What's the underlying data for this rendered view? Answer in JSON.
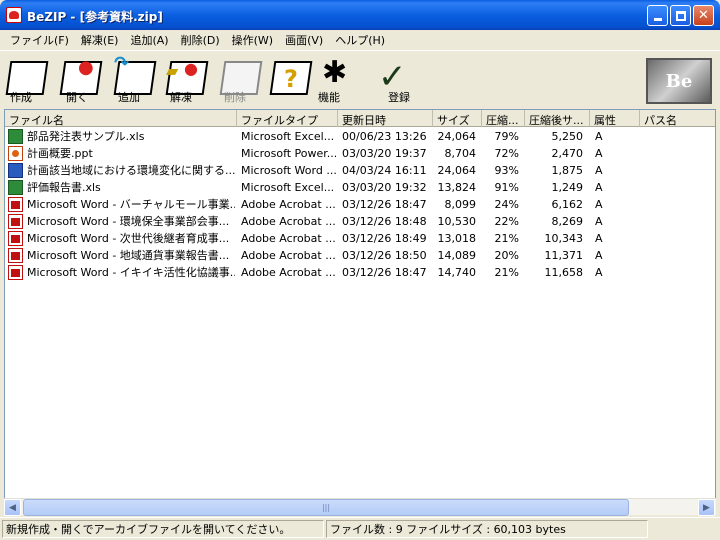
{
  "window": {
    "title": "BeZIP - [参考資料.zip]"
  },
  "menubar": {
    "items": [
      "ファイル(F)",
      "解凍(E)",
      "追加(A)",
      "削除(D)",
      "操作(W)",
      "画面(V)",
      "ヘルプ(H)"
    ]
  },
  "toolbar": {
    "items": [
      {
        "label": "作成",
        "icon": "new-archive-icon",
        "enabled": true
      },
      {
        "label": "開く",
        "icon": "open-archive-icon",
        "enabled": true
      },
      {
        "label": "追加",
        "icon": "add-files-icon",
        "enabled": true
      },
      {
        "label": "解凍",
        "icon": "extract-icon",
        "enabled": true
      },
      {
        "label": "削除",
        "icon": "delete-icon",
        "enabled": false
      },
      {
        "label": "?",
        "icon": "help-icon",
        "enabled": true
      },
      {
        "label": "機能",
        "icon": "functions-icon",
        "enabled": true
      },
      {
        "label": "登録",
        "icon": "register-check-icon",
        "enabled": true
      }
    ],
    "logo_text": "Be"
  },
  "list": {
    "columns": [
      "ファイル名",
      "ファイルタイプ",
      "更新日時",
      "サイズ",
      "圧縮...",
      "圧縮後サ...",
      "属性",
      "パス名"
    ],
    "rows": [
      {
        "icon": "xls",
        "name": "部品発注表サンプル.xls",
        "type": "Microsoft Excel...",
        "date": "00/06/23 13:26",
        "size": "24,064",
        "ratio": "79%",
        "packed": "5,250",
        "attr": "A",
        "path": ""
      },
      {
        "icon": "ppt",
        "name": "計画概要.ppt",
        "type": "Microsoft Power...",
        "date": "03/03/20 19:37",
        "size": "8,704",
        "ratio": "72%",
        "packed": "2,470",
        "attr": "A",
        "path": ""
      },
      {
        "icon": "doc",
        "name": "計画該当地域における環境変化に関する...",
        "type": "Microsoft Word ...",
        "date": "04/03/24 16:11",
        "size": "24,064",
        "ratio": "93%",
        "packed": "1,875",
        "attr": "A",
        "path": ""
      },
      {
        "icon": "xls",
        "name": "評価報告書.xls",
        "type": "Microsoft Excel...",
        "date": "03/03/20 19:32",
        "size": "13,824",
        "ratio": "91%",
        "packed": "1,249",
        "attr": "A",
        "path": ""
      },
      {
        "icon": "pdf",
        "name": "Microsoft Word - バーチャルモール事業...",
        "type": "Adobe Acrobat ...",
        "date": "03/12/26 18:47",
        "size": "8,099",
        "ratio": "24%",
        "packed": "6,162",
        "attr": "A",
        "path": ""
      },
      {
        "icon": "pdf",
        "name": "Microsoft Word - 環境保全事業部会事...",
        "type": "Adobe Acrobat ...",
        "date": "03/12/26 18:48",
        "size": "10,530",
        "ratio": "22%",
        "packed": "8,269",
        "attr": "A",
        "path": ""
      },
      {
        "icon": "pdf",
        "name": "Microsoft Word - 次世代後継者育成事...",
        "type": "Adobe Acrobat ...",
        "date": "03/12/26 18:49",
        "size": "13,018",
        "ratio": "21%",
        "packed": "10,343",
        "attr": "A",
        "path": ""
      },
      {
        "icon": "pdf",
        "name": "Microsoft Word - 地域通貨事業報告書...",
        "type": "Adobe Acrobat ...",
        "date": "03/12/26 18:50",
        "size": "14,089",
        "ratio": "20%",
        "packed": "11,371",
        "attr": "A",
        "path": ""
      },
      {
        "icon": "pdf",
        "name": "Microsoft Word - イキイキ活性化協議事...",
        "type": "Adobe Acrobat ...",
        "date": "03/12/26 18:47",
        "size": "14,740",
        "ratio": "21%",
        "packed": "11,658",
        "attr": "A",
        "path": ""
      }
    ]
  },
  "status": {
    "message": "新規作成・開くでアーカイブファイルを開いてください。",
    "file_info": "ファイル数 : 9  ファイルサイズ : 60,103 bytes"
  },
  "colors": {
    "titlebar": "#0a5fe0",
    "window_bg": "#ece9d8",
    "list_bg": "#ffffff"
  }
}
